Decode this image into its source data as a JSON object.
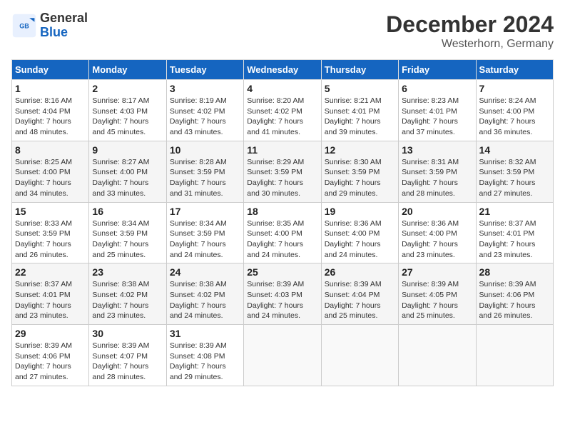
{
  "header": {
    "logo_line1": "General",
    "logo_line2": "Blue",
    "month_year": "December 2024",
    "location": "Westerhorn, Germany"
  },
  "weekdays": [
    "Sunday",
    "Monday",
    "Tuesday",
    "Wednesday",
    "Thursday",
    "Friday",
    "Saturday"
  ],
  "weeks": [
    [
      {
        "day": "1",
        "sunrise": "8:16 AM",
        "sunset": "4:04 PM",
        "daylight": "7 hours and 48 minutes."
      },
      {
        "day": "2",
        "sunrise": "8:17 AM",
        "sunset": "4:03 PM",
        "daylight": "7 hours and 45 minutes."
      },
      {
        "day": "3",
        "sunrise": "8:19 AM",
        "sunset": "4:02 PM",
        "daylight": "7 hours and 43 minutes."
      },
      {
        "day": "4",
        "sunrise": "8:20 AM",
        "sunset": "4:02 PM",
        "daylight": "7 hours and 41 minutes."
      },
      {
        "day": "5",
        "sunrise": "8:21 AM",
        "sunset": "4:01 PM",
        "daylight": "7 hours and 39 minutes."
      },
      {
        "day": "6",
        "sunrise": "8:23 AM",
        "sunset": "4:01 PM",
        "daylight": "7 hours and 37 minutes."
      },
      {
        "day": "7",
        "sunrise": "8:24 AM",
        "sunset": "4:00 PM",
        "daylight": "7 hours and 36 minutes."
      }
    ],
    [
      {
        "day": "8",
        "sunrise": "8:25 AM",
        "sunset": "4:00 PM",
        "daylight": "7 hours and 34 minutes."
      },
      {
        "day": "9",
        "sunrise": "8:27 AM",
        "sunset": "4:00 PM",
        "daylight": "7 hours and 33 minutes."
      },
      {
        "day": "10",
        "sunrise": "8:28 AM",
        "sunset": "3:59 PM",
        "daylight": "7 hours and 31 minutes."
      },
      {
        "day": "11",
        "sunrise": "8:29 AM",
        "sunset": "3:59 PM",
        "daylight": "7 hours and 30 minutes."
      },
      {
        "day": "12",
        "sunrise": "8:30 AM",
        "sunset": "3:59 PM",
        "daylight": "7 hours and 29 minutes."
      },
      {
        "day": "13",
        "sunrise": "8:31 AM",
        "sunset": "3:59 PM",
        "daylight": "7 hours and 28 minutes."
      },
      {
        "day": "14",
        "sunrise": "8:32 AM",
        "sunset": "3:59 PM",
        "daylight": "7 hours and 27 minutes."
      }
    ],
    [
      {
        "day": "15",
        "sunrise": "8:33 AM",
        "sunset": "3:59 PM",
        "daylight": "7 hours and 26 minutes."
      },
      {
        "day": "16",
        "sunrise": "8:34 AM",
        "sunset": "3:59 PM",
        "daylight": "7 hours and 25 minutes."
      },
      {
        "day": "17",
        "sunrise": "8:34 AM",
        "sunset": "3:59 PM",
        "daylight": "7 hours and 24 minutes."
      },
      {
        "day": "18",
        "sunrise": "8:35 AM",
        "sunset": "4:00 PM",
        "daylight": "7 hours and 24 minutes."
      },
      {
        "day": "19",
        "sunrise": "8:36 AM",
        "sunset": "4:00 PM",
        "daylight": "7 hours and 24 minutes."
      },
      {
        "day": "20",
        "sunrise": "8:36 AM",
        "sunset": "4:00 PM",
        "daylight": "7 hours and 23 minutes."
      },
      {
        "day": "21",
        "sunrise": "8:37 AM",
        "sunset": "4:01 PM",
        "daylight": "7 hours and 23 minutes."
      }
    ],
    [
      {
        "day": "22",
        "sunrise": "8:37 AM",
        "sunset": "4:01 PM",
        "daylight": "7 hours and 23 minutes."
      },
      {
        "day": "23",
        "sunrise": "8:38 AM",
        "sunset": "4:02 PM",
        "daylight": "7 hours and 23 minutes."
      },
      {
        "day": "24",
        "sunrise": "8:38 AM",
        "sunset": "4:02 PM",
        "daylight": "7 hours and 24 minutes."
      },
      {
        "day": "25",
        "sunrise": "8:39 AM",
        "sunset": "4:03 PM",
        "daylight": "7 hours and 24 minutes."
      },
      {
        "day": "26",
        "sunrise": "8:39 AM",
        "sunset": "4:04 PM",
        "daylight": "7 hours and 25 minutes."
      },
      {
        "day": "27",
        "sunrise": "8:39 AM",
        "sunset": "4:05 PM",
        "daylight": "7 hours and 25 minutes."
      },
      {
        "day": "28",
        "sunrise": "8:39 AM",
        "sunset": "4:06 PM",
        "daylight": "7 hours and 26 minutes."
      }
    ],
    [
      {
        "day": "29",
        "sunrise": "8:39 AM",
        "sunset": "4:06 PM",
        "daylight": "7 hours and 27 minutes."
      },
      {
        "day": "30",
        "sunrise": "8:39 AM",
        "sunset": "4:07 PM",
        "daylight": "7 hours and 28 minutes."
      },
      {
        "day": "31",
        "sunrise": "8:39 AM",
        "sunset": "4:08 PM",
        "daylight": "7 hours and 29 minutes."
      },
      null,
      null,
      null,
      null
    ]
  ],
  "labels": {
    "sunrise": "Sunrise:",
    "sunset": "Sunset:",
    "daylight": "Daylight:"
  }
}
